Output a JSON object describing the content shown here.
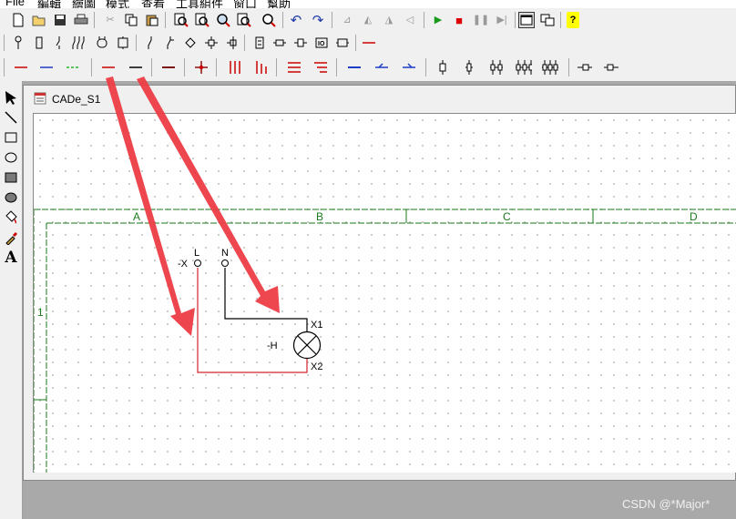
{
  "menu": [
    "File",
    "編輯",
    "繪圖",
    "模式",
    "查看",
    "工具組件",
    "窗口",
    "幫助"
  ],
  "toolbar_main": [
    "new-file-icon",
    "open-folder-icon",
    "save-icon",
    "print-icon",
    "cut-icon",
    "copy-icon",
    "paste-icon",
    "zoom-area-icon",
    "zoom-fit-icon",
    "zoom-search-icon",
    "zoom-page-icon",
    "zoom-pan-icon",
    "undo-icon",
    "redo-icon",
    "align-left-icon",
    "mirror-icon",
    "flip-icon",
    "align-right-icon",
    "run-icon",
    "stop-icon",
    "pause-icon",
    "step-icon",
    "window-mode-icon",
    "window-tile-icon",
    "help-icon"
  ],
  "toolbar_symbols": [
    "terminal-symbol-icon",
    "fuse-symbol-icon",
    "switch-symbol-icon",
    "multi-switch-symbol-icon",
    "coil-symbol-icon",
    "contact-block-icon",
    "no-contact-icon",
    "nc-contact-icon",
    "junction-icon",
    "cross-connect-icon",
    "tee-connect-icon",
    "relay-symbol-icon",
    "connector-symbol-icon",
    "plug-symbol-icon",
    "io-symbol-icon",
    "module-symbol-icon",
    "red-line-icon"
  ],
  "toolbar_lines": [
    "red-wire-icon",
    "blue-wire-icon",
    "green-wire-icon",
    "red-wire-selected-icon",
    "black-wire-icon",
    "brown-wire-icon",
    "red-node-icon",
    "three-phase-bus-icon",
    "three-phase-tap-icon",
    "multi-line-icon",
    "multi-line-tap-icon",
    "blue-line-icon",
    "blue-tap-icon",
    "blue-tee-icon",
    "single-pole-icon",
    "double-pole-icon",
    "triple-pole-icon",
    "four-pole-icon",
    "five-pole-icon",
    "connector-male-icon",
    "connector-female-icon"
  ],
  "left_tools": [
    "pointer-icon",
    "line-tool-icon",
    "rectangle-tool-icon",
    "ellipse-tool-icon",
    "filled-rectangle-tool-icon",
    "filled-ellipse-tool-icon",
    "fill-bucket-icon",
    "color-picker-icon",
    "text-tool-icon"
  ],
  "document": {
    "title": "CADe_S1",
    "columns": [
      "A",
      "B",
      "C",
      "D"
    ],
    "rows": [
      "1"
    ],
    "terminal_l_label": "L",
    "terminal_n_label": "N",
    "terminal_tag": "-X",
    "lamp_tag": "-H",
    "lamp_pin_top": "X1",
    "lamp_pin_bottom": "X2"
  },
  "colors": {
    "frame_green": "#1a7a1a",
    "wire_red": "#d0242c",
    "wire_black": "#000000",
    "annotation_arrow": "#ee3d46",
    "mdi_background": "#a9a9a9"
  },
  "watermark": "CSDN @*Major*"
}
